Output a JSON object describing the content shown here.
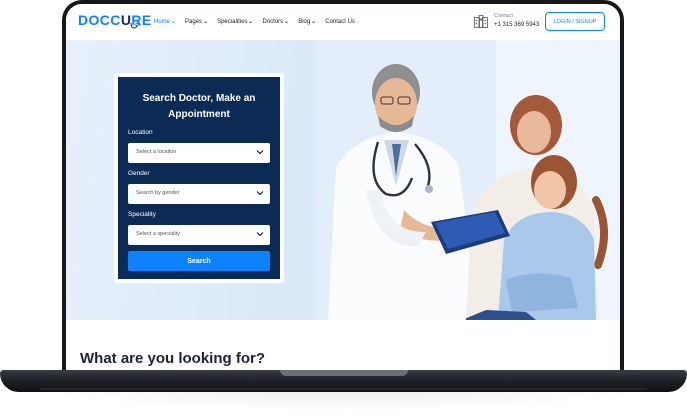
{
  "brand": {
    "logo_text_left": "DOCC",
    "logo_text_u": "U",
    "logo_text_right": "RE",
    "accent": "#0e82fd",
    "navy": "#0b2b55"
  },
  "nav": {
    "items": [
      {
        "label": "Home",
        "active": true
      },
      {
        "label": "Pages",
        "active": false
      },
      {
        "label": "Specialities",
        "active": false
      },
      {
        "label": "Doctors",
        "active": false
      },
      {
        "label": "Blog",
        "active": false
      },
      {
        "label": "Contact Us",
        "active": false
      }
    ],
    "chevron": "⌄"
  },
  "contact": {
    "label": "Contact",
    "phone": "+1 315 369 5943",
    "icon": "hospital-icon"
  },
  "auth": {
    "login_label": "LOGIN / SIGNUP"
  },
  "search_form": {
    "title": "Search Doctor, Make an Appointment",
    "location": {
      "label": "Location",
      "placeholder": "Select a location"
    },
    "gender": {
      "label": "Gender",
      "placeholder": "Search by gender"
    },
    "speciality": {
      "label": "Speciality",
      "placeholder": "Select a speciality"
    },
    "search_label": "Search"
  },
  "hero": {
    "image": "doctor-with-mother-and-daughter-photo"
  },
  "section": {
    "heading": "What are you looking for?"
  }
}
